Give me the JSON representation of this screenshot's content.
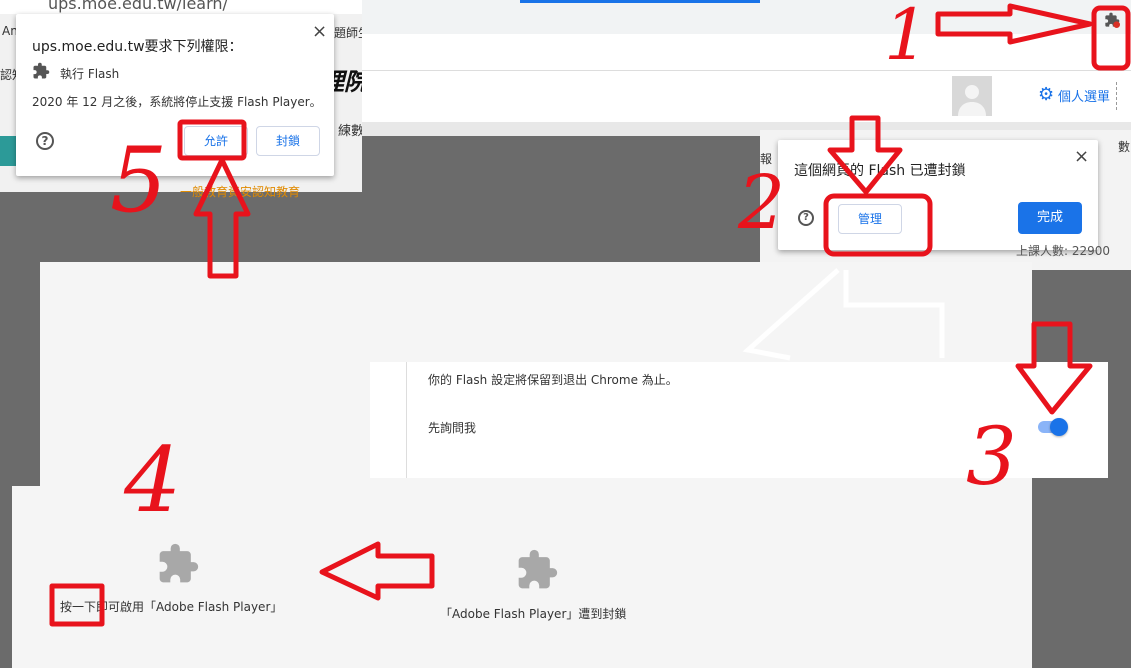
{
  "top_left": {
    "url": "ups.moe.edu.tw/learn/",
    "side_a": "An",
    "side_b": "認知",
    "side_c": "題師生",
    "side_d": "理院",
    "side_e": "練數",
    "side_f": "一般教育資安認知教育"
  },
  "permission_dialog": {
    "title": "ups.moe.edu.tw要求下列權限：",
    "item": "執行 Flash",
    "notice": "2020 年 12 月之後，系統將停止支援 Flash Player。",
    "allow_label": "允許",
    "block_label": "封鎖",
    "close_icon": "×",
    "help_icon": "?"
  },
  "header": {
    "settings_label": "個人選單",
    "gear_icon": "⚙"
  },
  "blocked_dialog": {
    "title": "這個網頁的 Flash 已遭封鎖",
    "manage_label": "管理",
    "done_label": "完成",
    "close_icon": "×",
    "help_icon": "?",
    "side_a": "報",
    "side_b": "數",
    "side_c": "上課人數: 22900"
  },
  "flash_settings": {
    "retain_text": "你的 Flash 設定將保留到退出 Chrome 為止。",
    "ask_label": "先詢問我",
    "ask_enabled": true
  },
  "plugin_placeholders": {
    "enable_text": "按一下即可啟用「Adobe Flash Player」",
    "blocked_text": "「Adobe Flash Player」遭到封鎖"
  },
  "annotations": {
    "step1": "1",
    "step2": "2",
    "step3": "3",
    "step4": "4",
    "step5": "5"
  },
  "colors": {
    "accent": "#1a73e8",
    "annotation": "#e8131c",
    "teal": "#2c9a98"
  }
}
